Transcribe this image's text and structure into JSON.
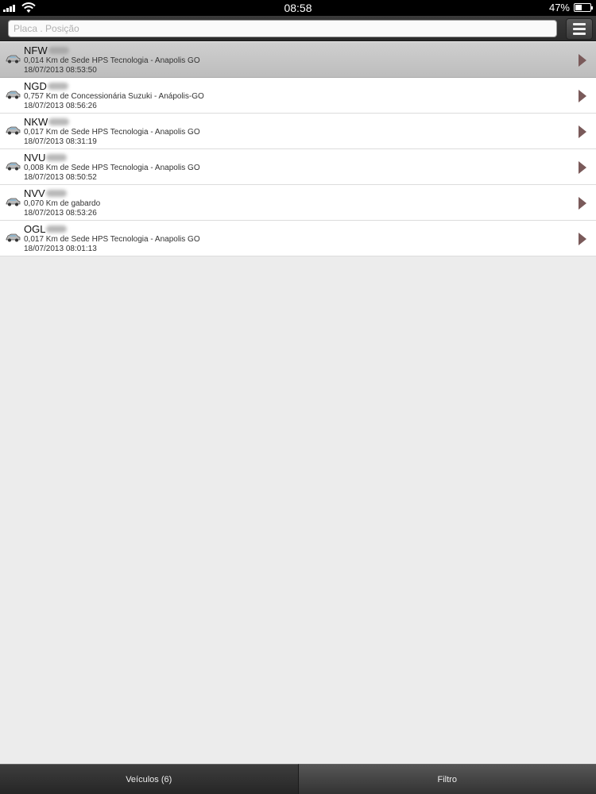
{
  "status_bar": {
    "time": "08:58",
    "battery": "47%",
    "battery_level": 0.47
  },
  "search": {
    "placeholder": "Placa . Posição",
    "value": ""
  },
  "menu": {
    "icon": "menu-icon"
  },
  "vehicles": [
    {
      "plate": "NFW",
      "desc": "0,014 Km de Sede HPS Tecnologia - Anapolis GO",
      "time": "18/07/2013 08:53:50",
      "selected": true
    },
    {
      "plate": "NGD",
      "desc": "0,757 Km de Concessionária Suzuki - Anápolis-GO",
      "time": "18/07/2013 08:56:26",
      "selected": false
    },
    {
      "plate": "NKW",
      "desc": "0,017 Km de Sede HPS Tecnologia - Anapolis GO",
      "time": "18/07/2013 08:31:19",
      "selected": false
    },
    {
      "plate": "NVU",
      "desc": "0,008 Km de Sede HPS Tecnologia - Anapolis GO",
      "time": "18/07/2013 08:50:52",
      "selected": false
    },
    {
      "plate": "NVV",
      "desc": "0,070 Km de gabardo",
      "time": "18/07/2013 08:53:26",
      "selected": false
    },
    {
      "plate": "OGL",
      "desc": "0,017 Km de Sede HPS Tecnologia - Anapolis GO",
      "time": "18/07/2013 08:01:13",
      "selected": false
    }
  ],
  "tabs": [
    {
      "label": "Veículos (6)",
      "active": true
    },
    {
      "label": "Filtro",
      "active": false
    }
  ]
}
